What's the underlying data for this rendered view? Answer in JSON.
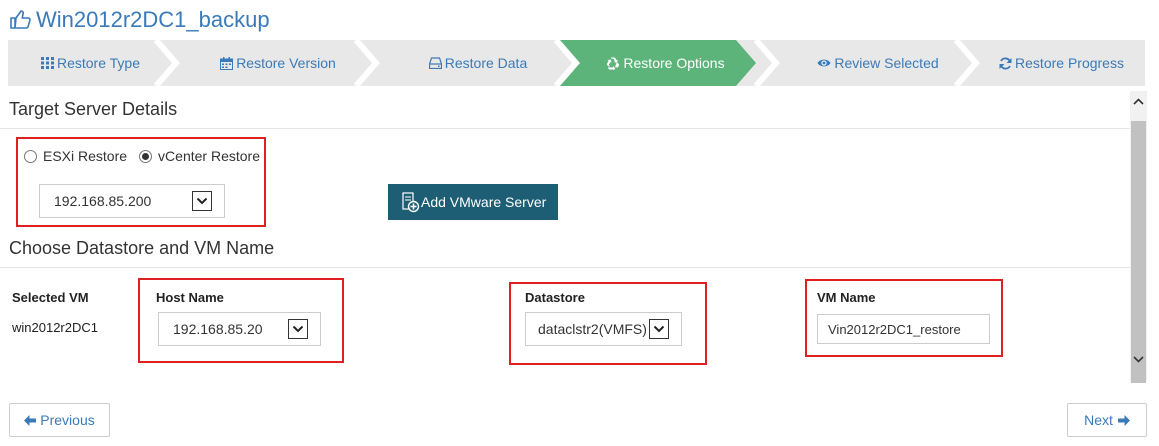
{
  "page": {
    "title": "Win2012r2DC1_backup",
    "title_icon": "thumb-right-icon"
  },
  "wizard": {
    "steps": [
      {
        "label": "Restore Type",
        "icon": "grid-icon",
        "active": false
      },
      {
        "label": "Restore Version",
        "icon": "calendar-icon",
        "active": false
      },
      {
        "label": "Restore Data",
        "icon": "drive-icon",
        "active": false
      },
      {
        "label": "Restore Options",
        "icon": "recycle-icon",
        "active": true
      },
      {
        "label": "Review Selected",
        "icon": "eye-icon",
        "active": false
      },
      {
        "label": "Restore Progress",
        "icon": "refresh-icon",
        "active": false
      }
    ],
    "colors": {
      "inactive": "#e8e8e8",
      "active": "#5cb47a",
      "separator": "#ffffff",
      "text": "#3a7ab8"
    }
  },
  "target_server": {
    "heading": "Target Server Details",
    "radio_options": [
      {
        "label": "ESXi Restore",
        "selected": false
      },
      {
        "label": "vCenter Restore",
        "selected": true
      }
    ],
    "server_select": {
      "value": "192.168.85.200"
    },
    "add_button": {
      "label": "Add VMware Server",
      "icon": "add-server-icon"
    }
  },
  "datastore_section": {
    "heading": "Choose Datastore and VM Name",
    "selected_vm": {
      "label": "Selected VM",
      "value": "win2012r2DC1"
    },
    "host": {
      "label": "Host Name",
      "value": "192.168.85.20"
    },
    "datastore": {
      "label": "Datastore",
      "value": "dataclstr2(VMFS)"
    },
    "vm_name": {
      "label": "VM Name",
      "value": "Vin2012r2DC1_restore"
    }
  },
  "footer": {
    "previous_label": "Previous",
    "next_label": "Next"
  },
  "colors": {
    "accent_blue": "#3a7ab8",
    "button_teal": "#1e5e74",
    "highlight_red": "#e02020"
  }
}
